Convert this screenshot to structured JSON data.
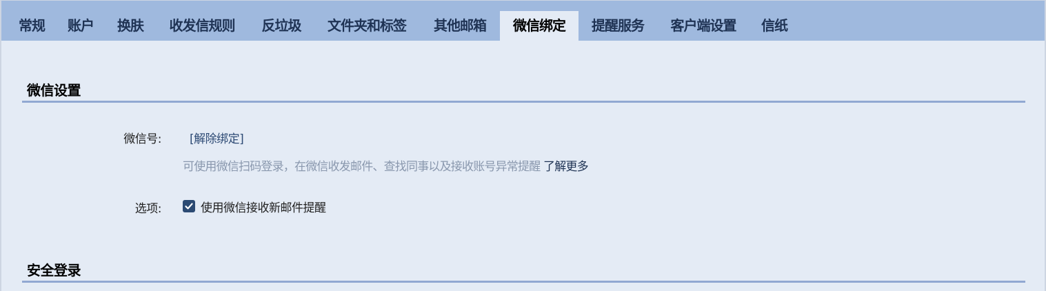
{
  "tabs": [
    {
      "label": "常规",
      "active": false
    },
    {
      "label": "账户",
      "active": false
    },
    {
      "label": "换肤",
      "active": false
    },
    {
      "label": "收发信规则",
      "active": false
    },
    {
      "label": "反垃圾",
      "active": false
    },
    {
      "label": "文件夹和标签",
      "active": false
    },
    {
      "label": "其他邮箱",
      "active": false
    },
    {
      "label": "微信绑定",
      "active": true
    },
    {
      "label": "提醒服务",
      "active": false
    },
    {
      "label": "客户端设置",
      "active": false
    },
    {
      "label": "信纸",
      "active": false
    }
  ],
  "wechat_section": {
    "title": "微信设置",
    "account_label": "微信号:",
    "unbind_link": "[解除绑定]",
    "hint": "可使用微信扫码登录，在微信收发邮件、查找同事以及接收账号异常提醒",
    "learn_more": "了解更多",
    "options_label": "选项:",
    "option_new_mail": {
      "label": "使用微信接收新邮件提醒",
      "checked": true
    }
  },
  "security_section": {
    "title": "安全登录"
  },
  "colors": {
    "tabbar": "#9fb9de",
    "panel": "#e4ebf5",
    "divider": "#91a8d2",
    "checkbox": "#2b4a73"
  }
}
